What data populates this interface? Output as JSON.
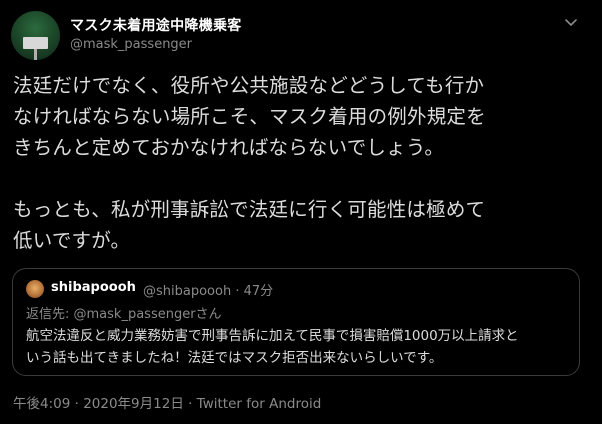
{
  "tweet": {
    "display_name": "マスク未着用途中降機乗客",
    "handle": "@mask_passenger",
    "body_lines": [
      "法廷だけでなく、役所や公共施設などどうしても行か",
      "なければならない場所こそ、マスク着用の例外規定を",
      "きちんと定めておかなければならないでしょう。",
      "",
      "もっとも、私が刑事訴訟で法廷に行く可能性は極めて",
      "低いですが。"
    ],
    "footer": "午後4:09 · 2020年9月12日 · Twitter for Android",
    "menu_icon": "chevron-down-icon"
  },
  "quote": {
    "display_name": "shibapoooh",
    "meta": "@shibapoooh · 47分",
    "reply_prefix": "返信先: ",
    "reply_mention": "@mask_passengerさん",
    "text_lines": [
      "航空法違反と威力業務妨害で刑事告訴に加えて民事で損害賠償1000万以上請求と",
      "いう話も出てきましたね！法廷ではマスク拒否出来ないらしいです。"
    ]
  }
}
